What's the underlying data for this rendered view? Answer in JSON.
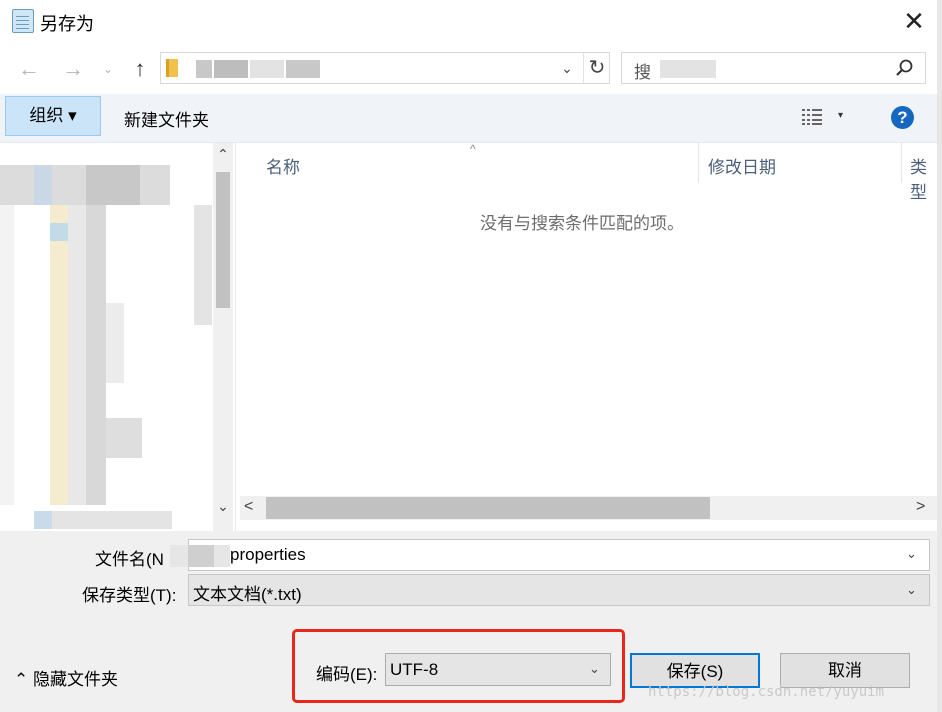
{
  "window": {
    "title": "另存为",
    "close_glyph": "✕"
  },
  "nav": {
    "back_glyph": "←",
    "forward_glyph": "→",
    "recent_glyph": "⌄",
    "up_glyph": "↑",
    "refresh_glyph": "↻",
    "address_chevron": "⌄"
  },
  "search": {
    "placeholder": "搜"
  },
  "toolbar": {
    "organize_label": "组织 ▾",
    "new_folder_label": "新建文件夹",
    "view_arrow": "▾",
    "help_label": "?"
  },
  "file_list": {
    "columns": [
      "名称",
      "修改日期",
      "类型"
    ],
    "sort_glyph": "^",
    "empty_message": "没有与搜索条件匹配的项。"
  },
  "scroll": {
    "up": "⌃",
    "down": "⌄",
    "left": "<",
    "right": ">"
  },
  "form": {
    "filename_label": "文件名(N",
    "filename_value": "properties",
    "filetype_label": "保存类型(T):",
    "filetype_value": "文本文档(*.txt)",
    "encoding_label": "编码(E):",
    "encoding_value": "UTF-8",
    "dropdown_glyph": "⌄"
  },
  "buttons": {
    "hide_folders": "⌃ 隐藏文件夹",
    "save": "保存(S)",
    "cancel": "取消"
  },
  "watermark": "https://blog.csdn.net/yuyuim",
  "colors": {
    "highlight_box": "#e8261c",
    "primary_border": "#0078d7",
    "organize_bg": "#cce4f7"
  }
}
